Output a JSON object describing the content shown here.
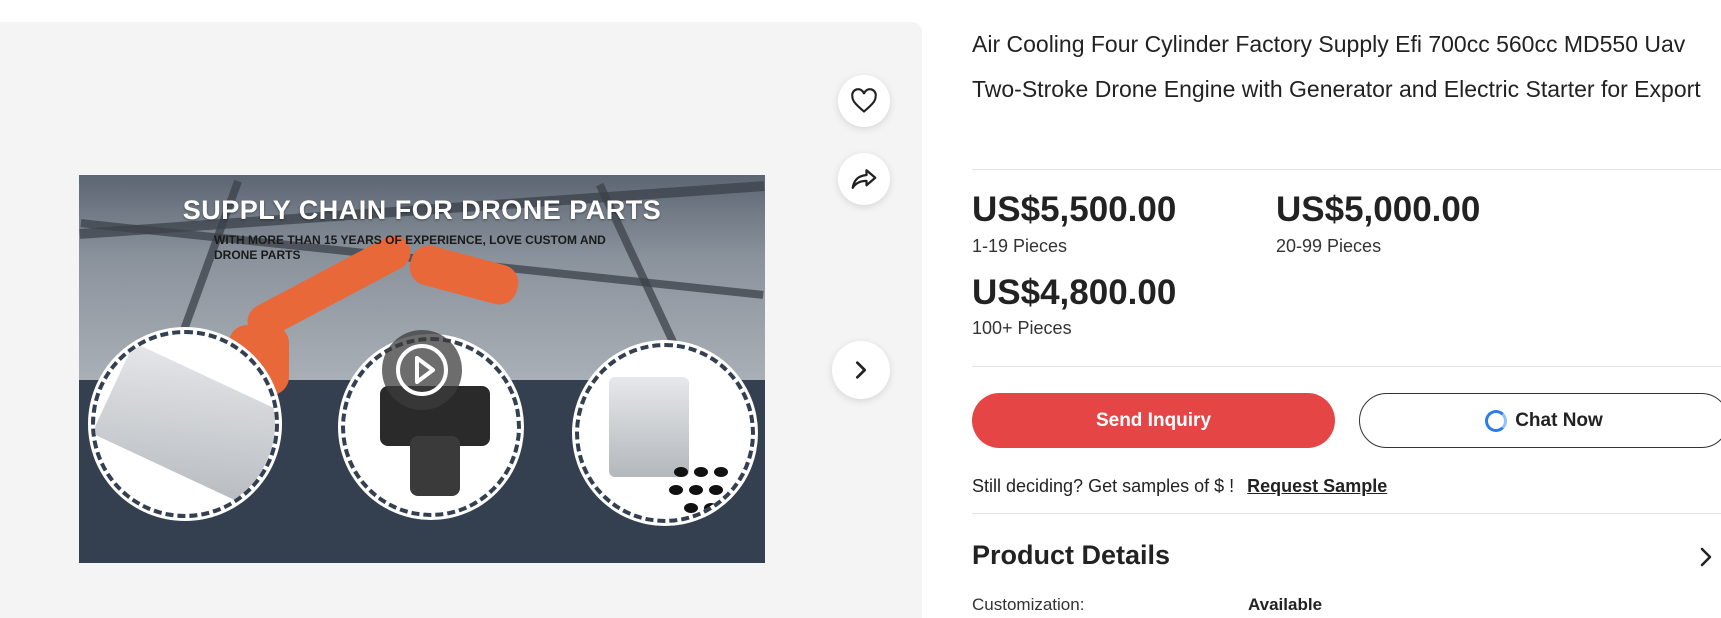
{
  "gallery": {
    "banner_title": "SUPPLY CHAIN FOR DRONE PARTS",
    "banner_subtitle": "WITH MORE THAN 15 YEARS OF EXPERIENCE, LOVE CUSTOM AND DRONE PARTS",
    "actions": [
      "heart-icon",
      "share-icon",
      "chevron-right-icon",
      "play-icon"
    ]
  },
  "product": {
    "title": "Air Cooling Four Cylinder Factory Supply Efi 700cc 560cc MD550 Uav Two-Stroke Drone Engine with Generator and Electric Starter for Export",
    "prices": [
      {
        "price": "US$5,500.00",
        "qty": "1-19 Pieces"
      },
      {
        "price": "US$5,000.00",
        "qty": "20-99 Pieces"
      },
      {
        "price": "US$4,800.00",
        "qty": "100+ Pieces"
      }
    ],
    "send_inquiry": "Send Inquiry",
    "chat_now": "Chat Now",
    "sample_text": "Still deciding? Get samples of $ !",
    "sample_link": "Request Sample",
    "details_title": "Product Details",
    "spec": {
      "label": "Customization:",
      "value": "Available"
    }
  },
  "colors": {
    "accent": "#e64545",
    "chat_icon": "#2b7de9"
  }
}
